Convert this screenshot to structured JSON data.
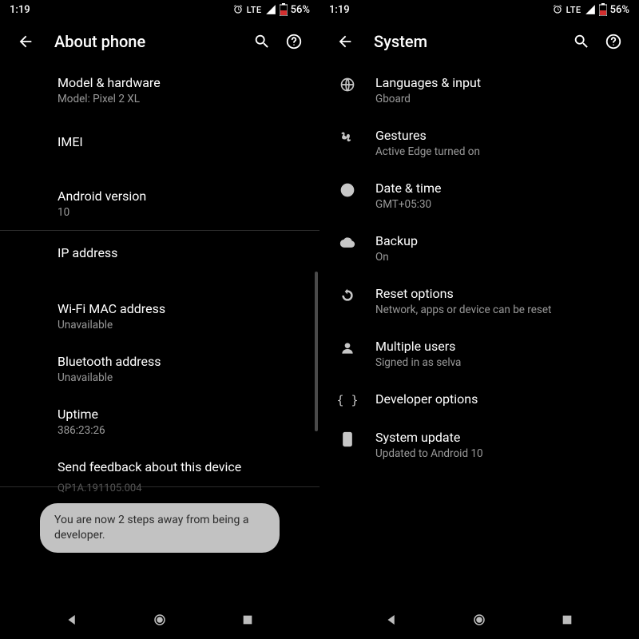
{
  "status": {
    "time": "1:19",
    "lte": "LTE",
    "battery": "56%"
  },
  "left": {
    "title": "About phone",
    "items": [
      {
        "title": "Model & hardware",
        "sub": "Model: Pixel 2 XL"
      },
      {
        "title": "IMEI",
        "sub": ""
      },
      {
        "title": "Android version",
        "sub": "10"
      }
    ],
    "divider_after": 2,
    "items2": [
      {
        "title": "IP address",
        "sub": ""
      },
      {
        "title": "Wi-Fi MAC address",
        "sub": "Unavailable"
      },
      {
        "title": "Bluetooth address",
        "sub": "Unavailable"
      },
      {
        "title": "Uptime",
        "sub": "386:23:26"
      },
      {
        "title": "Send feedback about this device",
        "sub": ""
      }
    ],
    "build_partial": "QP1A.191105.004",
    "toast": "You are now 2 steps away from being a developer."
  },
  "right": {
    "title": "System",
    "items": [
      {
        "icon": "globe-icon",
        "title": "Languages & input",
        "sub": "Gboard"
      },
      {
        "icon": "gesture-icon",
        "title": "Gestures",
        "sub": "Active Edge turned on"
      },
      {
        "icon": "clock-icon",
        "title": "Date & time",
        "sub": "GMT+05:30"
      },
      {
        "icon": "cloud-icon",
        "title": "Backup",
        "sub": "On"
      },
      {
        "icon": "restore-icon",
        "title": "Reset options",
        "sub": "Network, apps or device can be reset"
      },
      {
        "icon": "person-icon",
        "title": "Multiple users",
        "sub": "Signed in as selva"
      },
      {
        "icon": "braces-icon",
        "title": "Developer options",
        "sub": ""
      },
      {
        "icon": "update-icon",
        "title": "System update",
        "sub": "Updated to Android 10"
      }
    ]
  }
}
